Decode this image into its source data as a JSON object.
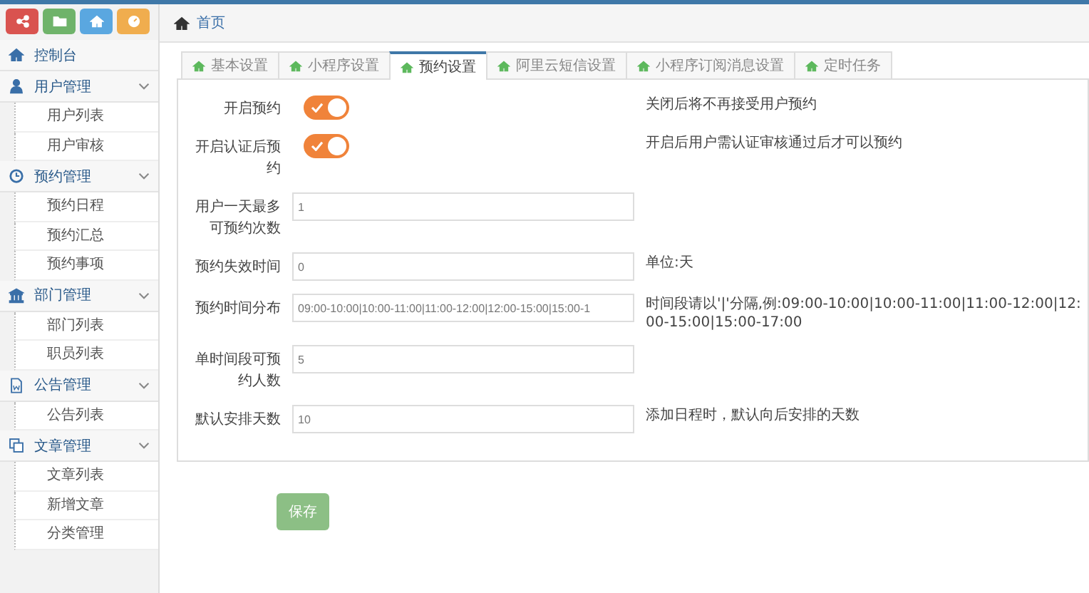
{
  "toolbar_buttons": [
    {
      "kind": "share",
      "color": "#d9534f"
    },
    {
      "kind": "folder",
      "color": "#6fb36a"
    },
    {
      "kind": "home",
      "color": "#5aa7e0"
    },
    {
      "kind": "gauge",
      "color": "#f0ad4e"
    }
  ],
  "sidebar": {
    "items": [
      {
        "label": "控制台",
        "kind": "home"
      },
      {
        "label": "用户管理",
        "kind": "user",
        "expanded": true,
        "children": [
          {
            "label": "用户列表"
          },
          {
            "label": "用户审核"
          }
        ]
      },
      {
        "label": "预约管理",
        "kind": "clock",
        "expanded": true,
        "children": [
          {
            "label": "预约日程"
          },
          {
            "label": "预约汇总"
          },
          {
            "label": "预约事项"
          }
        ]
      },
      {
        "label": "部门管理",
        "kind": "bank",
        "expanded": true,
        "children": [
          {
            "label": "部门列表"
          },
          {
            "label": "职员列表"
          }
        ]
      },
      {
        "label": "公告管理",
        "kind": "doc",
        "expanded": true,
        "children": [
          {
            "label": "公告列表"
          }
        ]
      },
      {
        "label": "文章管理",
        "kind": "copy",
        "expanded": true,
        "children": [
          {
            "label": "文章列表"
          },
          {
            "label": "新增文章"
          },
          {
            "label": "分类管理"
          }
        ]
      }
    ]
  },
  "breadcrumb": "首页",
  "tabs": [
    {
      "label": "基本设置",
      "selected": false
    },
    {
      "label": "小程序设置",
      "selected": false
    },
    {
      "label": "预约设置",
      "selected": true
    },
    {
      "label": "阿里云短信设置",
      "selected": false
    },
    {
      "label": "小程序订阅消息设置",
      "selected": false
    },
    {
      "label": "定时任务",
      "selected": false
    }
  ],
  "form": [
    {
      "kind": "switch",
      "label": "开启预约",
      "on": true,
      "hint": "关闭后将不再接受用户预约"
    },
    {
      "kind": "switch",
      "label": "开启认证后预约",
      "on": true,
      "hint": "开启后用户需认证审核通过后才可以预约"
    },
    {
      "kind": "input",
      "label": "用户一天最多可预约次数",
      "value": "1"
    },
    {
      "kind": "input",
      "label": "预约失效时间",
      "value": "0",
      "hint": "单位:天"
    },
    {
      "kind": "input",
      "label": "预约时间分布",
      "value": "09:00-10:00|10:00-11:00|11:00-12:00|12:00-15:00|15:00-1",
      "hint": "时间段请以'|'分隔,例:09:00-10:00|10:00-11:00|11:00-12:00|12:00-15:00|15:00-17:00"
    },
    {
      "kind": "input",
      "label": "单时间段可预约人数",
      "value": "5"
    },
    {
      "kind": "input",
      "label": "默认安排天数",
      "value": "10",
      "hint": "添加日程时，默认向后安排的天数"
    }
  ],
  "save_button": "保存"
}
